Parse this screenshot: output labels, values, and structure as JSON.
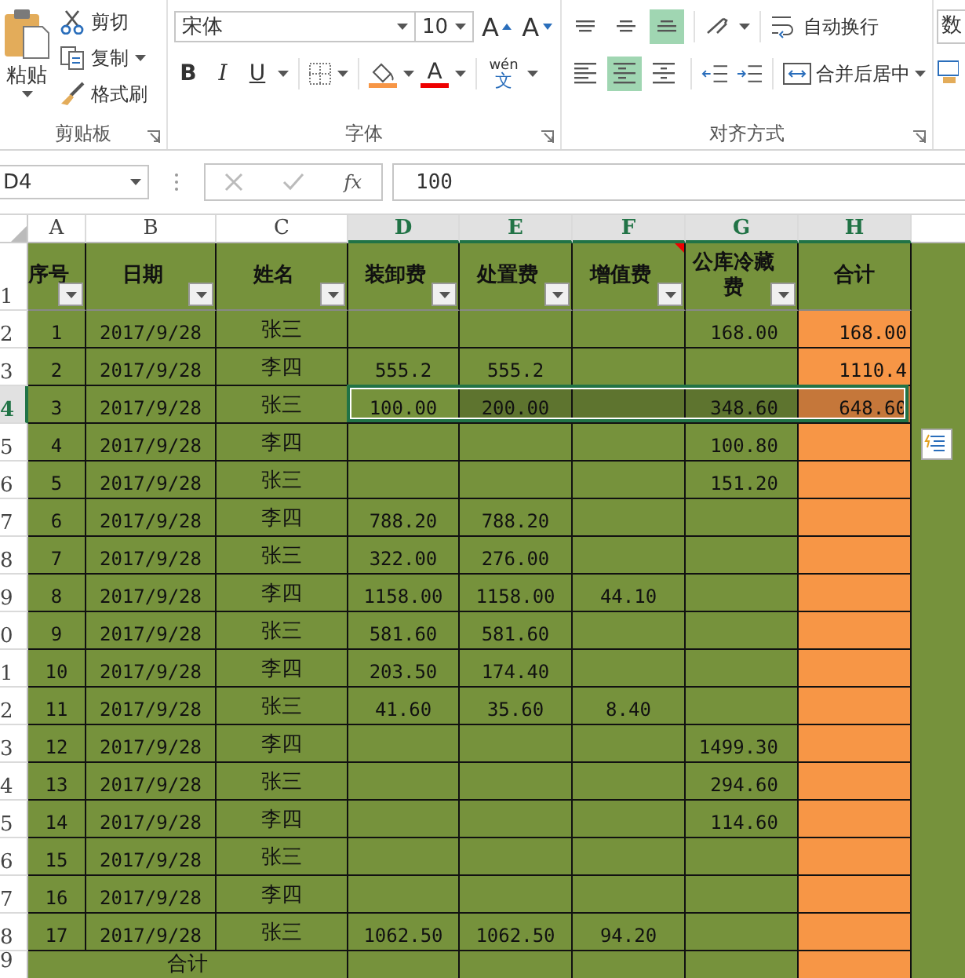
{
  "ribbon": {
    "clipboard": {
      "paste": "粘贴",
      "cut": "剪切",
      "copy": "复制",
      "format_painter": "格式刷",
      "label": "剪贴板"
    },
    "font": {
      "font_name": "宋体",
      "font_size": "10",
      "grow": "A",
      "shrink": "A",
      "bold": "B",
      "italic": "I",
      "underline": "U",
      "font_color": "A",
      "phonetic": "wén",
      "phonetic_sub": "文",
      "label": "字体"
    },
    "alignment": {
      "top_row": [
        {
          "kind": "top",
          "selected": false
        },
        {
          "kind": "middle",
          "selected": false
        },
        {
          "kind": "bottom",
          "selected": true
        }
      ],
      "bottom_row": [
        {
          "kind": "left",
          "selected": false
        },
        {
          "kind": "center",
          "selected": true
        },
        {
          "kind": "right",
          "selected": false
        }
      ],
      "wrap_text": "自动换行",
      "merge_center": "合并后居中",
      "label": "对齐方式"
    },
    "number_partial": "数"
  },
  "formula_bar": {
    "name_box": "D4",
    "function_label": "fx",
    "value": "100"
  },
  "columns": [
    {
      "letter": "A",
      "selected": false
    },
    {
      "letter": "B",
      "selected": false
    },
    {
      "letter": "C",
      "selected": false
    },
    {
      "letter": "D",
      "selected": true
    },
    {
      "letter": "E",
      "selected": true
    },
    {
      "letter": "F",
      "selected": true
    },
    {
      "letter": "G",
      "selected": true
    },
    {
      "letter": "H",
      "selected": true
    }
  ],
  "header_row": {
    "row": "1",
    "cells": [
      {
        "text": "序号",
        "filter": true,
        "comment": false
      },
      {
        "text": "日期",
        "filter": true,
        "comment": false
      },
      {
        "text": "姓名",
        "filter": true,
        "comment": false
      },
      {
        "text": "装卸费",
        "filter": true,
        "comment": false
      },
      {
        "text": "处置费",
        "filter": true,
        "comment": false
      },
      {
        "text": "增值费",
        "filter": true,
        "comment": true
      },
      {
        "text": "公库冷藏费",
        "filter": true,
        "comment": false
      },
      {
        "text": "合计",
        "filter": false,
        "comment": false
      }
    ]
  },
  "rows": [
    {
      "row": "2",
      "selected": false,
      "cells": [
        "1",
        "2017/9/28",
        "张三",
        null,
        null,
        null,
        "168.00",
        "168.00"
      ]
    },
    {
      "row": "3",
      "selected": false,
      "cells": [
        "2",
        "2017/9/28",
        "李四",
        "555.2",
        "555.2",
        null,
        null,
        "1110.4"
      ]
    },
    {
      "row": "4",
      "selected": true,
      "cells": [
        "3",
        "2017/9/28",
        "张三",
        "100.00",
        "200.00",
        null,
        "348.60",
        "648.60"
      ]
    },
    {
      "row": "5",
      "selected": false,
      "cells": [
        "4",
        "2017/9/28",
        "李四",
        null,
        null,
        null,
        "100.80",
        null
      ]
    },
    {
      "row": "6",
      "selected": false,
      "cells": [
        "5",
        "2017/9/28",
        "张三",
        null,
        null,
        null,
        "151.20",
        null
      ]
    },
    {
      "row": "7",
      "selected": false,
      "cells": [
        "6",
        "2017/9/28",
        "李四",
        "788.20",
        "788.20",
        null,
        null,
        null
      ]
    },
    {
      "row": "8",
      "selected": false,
      "cells": [
        "7",
        "2017/9/28",
        "张三",
        "322.00",
        "276.00",
        null,
        null,
        null
      ]
    },
    {
      "row": "9",
      "selected": false,
      "cells": [
        "8",
        "2017/9/28",
        "李四",
        "1158.00",
        "1158.00",
        "44.10",
        null,
        null
      ]
    },
    {
      "row": "0",
      "selected": false,
      "cells": [
        "9",
        "2017/9/28",
        "张三",
        "581.60",
        "581.60",
        null,
        null,
        null
      ]
    },
    {
      "row": "1",
      "selected": false,
      "cells": [
        "10",
        "2017/9/28",
        "李四",
        "203.50",
        "174.40",
        null,
        null,
        null
      ]
    },
    {
      "row": "2",
      "selected": false,
      "cells": [
        "11",
        "2017/9/28",
        "张三",
        "41.60",
        "35.60",
        "8.40",
        null,
        null
      ]
    },
    {
      "row": "3",
      "selected": false,
      "cells": [
        "12",
        "2017/9/28",
        "李四",
        null,
        null,
        null,
        "1499.30",
        null
      ]
    },
    {
      "row": "4",
      "selected": false,
      "cells": [
        "13",
        "2017/9/28",
        "张三",
        null,
        null,
        null,
        "294.60",
        null
      ]
    },
    {
      "row": "5",
      "selected": false,
      "cells": [
        "14",
        "2017/9/28",
        "李四",
        null,
        null,
        null,
        "114.60",
        null
      ]
    },
    {
      "row": "6",
      "selected": false,
      "cells": [
        "15",
        "2017/9/28",
        "张三",
        null,
        null,
        null,
        null,
        null
      ]
    },
    {
      "row": "7",
      "selected": false,
      "cells": [
        "16",
        "2017/9/28",
        "李四",
        null,
        null,
        null,
        null,
        null
      ]
    },
    {
      "row": "8",
      "selected": false,
      "cells": [
        "17",
        "2017/9/28",
        "张三",
        "1062.50",
        "1062.50",
        "94.20",
        null,
        null
      ]
    }
  ],
  "total_row": {
    "row": "9",
    "label": "合计"
  }
}
